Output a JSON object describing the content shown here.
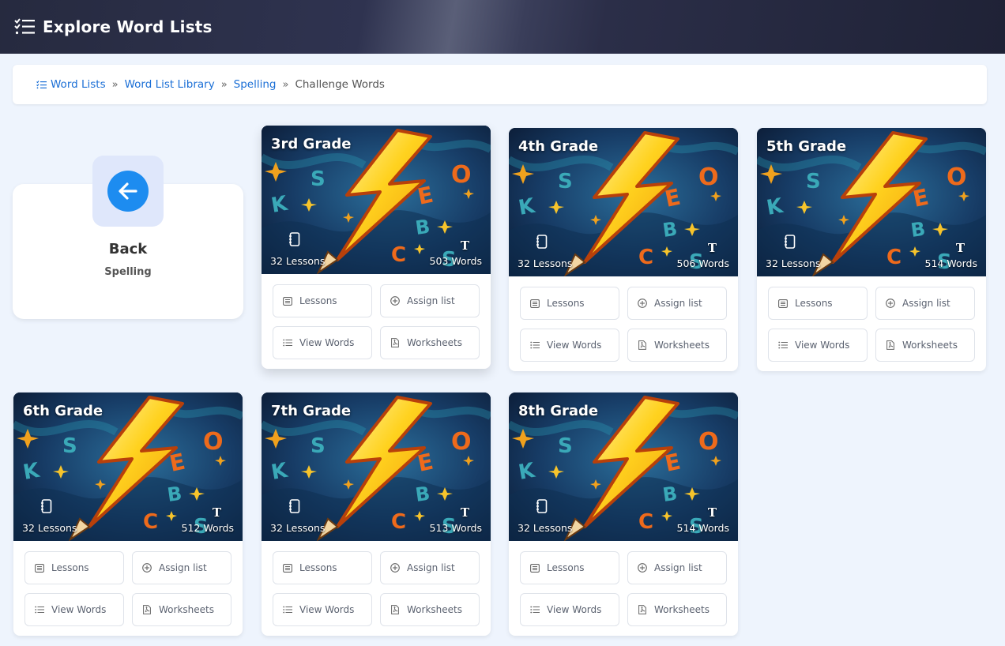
{
  "header": {
    "title": "Explore Word Lists",
    "icon": "checklist-icon"
  },
  "breadcrumb": {
    "items": [
      {
        "label": "Word Lists",
        "icon": "list-icon"
      },
      {
        "label": "Word List Library"
      },
      {
        "label": "Spelling"
      }
    ],
    "current": "Challenge Words",
    "separator": "»"
  },
  "back_card": {
    "title": "Back",
    "subtitle": "Spelling",
    "icon": "arrow-left-icon"
  },
  "actions": {
    "lessons": "Lessons",
    "assign": "Assign list",
    "view_words": "View Words",
    "worksheets": "Worksheets"
  },
  "cards": [
    {
      "grade": "3rd Grade",
      "lessons": "32 Lessons",
      "words": "503 Words"
    },
    {
      "grade": "4th Grade",
      "lessons": "32 Lessons",
      "words": "506 Words"
    },
    {
      "grade": "5th Grade",
      "lessons": "32 Lessons",
      "words": "514 Words"
    },
    {
      "grade": "6th Grade",
      "lessons": "32 Lessons",
      "words": "512 Words"
    },
    {
      "grade": "7th Grade",
      "lessons": "32 Lessons",
      "words": "513 Words"
    },
    {
      "grade": "8th Grade",
      "lessons": "32 Lessons",
      "words": "514 Words"
    }
  ],
  "colors": {
    "accent": "#1b6fd6",
    "back_button": "#1d8cf0",
    "header_bg": "#2b2e48"
  }
}
